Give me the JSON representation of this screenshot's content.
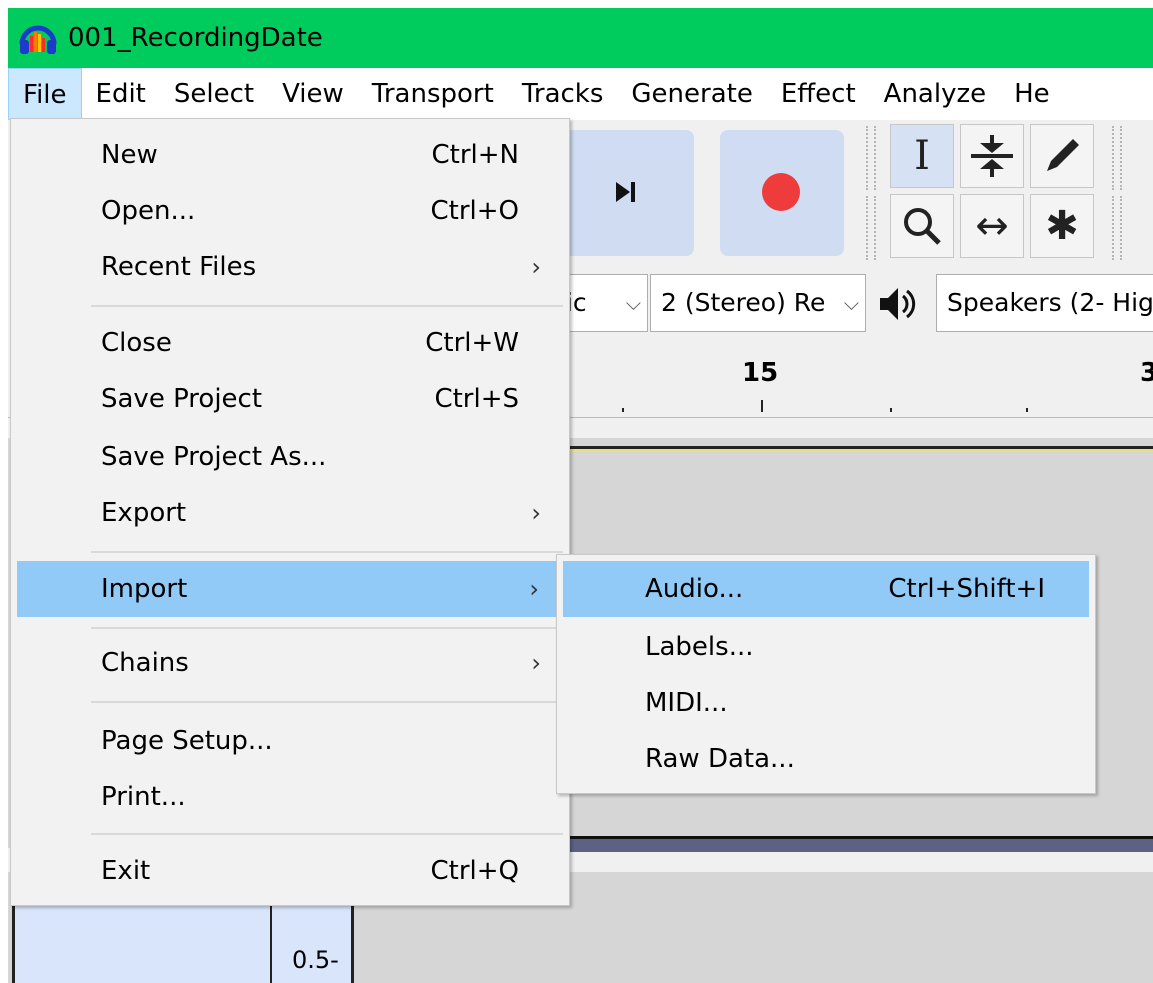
{
  "window": {
    "title": "001_RecordingDate"
  },
  "menubar": {
    "items": [
      "File",
      "Edit",
      "Select",
      "View",
      "Transport",
      "Tracks",
      "Generate",
      "Effect",
      "Analyze",
      "He"
    ]
  },
  "toolbar": {
    "skip_end_icon": "skip-to-end-icon",
    "record_icon": "record-icon",
    "record_color": "#ee3b3b",
    "tools": {
      "selection": "I",
      "envelope": "envelope-icon",
      "draw": "pencil-icon",
      "zoom": "zoom-icon",
      "timeshift": "↔",
      "multi": "✱"
    }
  },
  "devices": {
    "host_partial": "lic",
    "channels": "2 (Stereo) Re",
    "output": "Speakers (2- Hig"
  },
  "ruler": {
    "tick_label": "15",
    "tick_label_right": "3"
  },
  "track": {
    "scale_label": "0.5-"
  },
  "file_menu": {
    "items": [
      {
        "label": "New",
        "shortcut": "Ctrl+N"
      },
      {
        "label": "Open...",
        "shortcut": "Ctrl+O"
      },
      {
        "label": "Recent Files",
        "arrow": "›"
      },
      {
        "label": "Close",
        "shortcut": "Ctrl+W"
      },
      {
        "label": "Save Project",
        "shortcut": "Ctrl+S"
      },
      {
        "label": "Save Project As..."
      },
      {
        "label": "Export",
        "arrow": "›"
      },
      {
        "label": "Import",
        "arrow": "›"
      },
      {
        "label": "Chains",
        "arrow": "›"
      },
      {
        "label": "Page Setup..."
      },
      {
        "label": "Print..."
      },
      {
        "label": "Exit",
        "shortcut": "Ctrl+Q"
      }
    ]
  },
  "import_submenu": {
    "items": [
      {
        "label": "Audio...",
        "shortcut": "Ctrl+Shift+I"
      },
      {
        "label": "Labels..."
      },
      {
        "label": "MIDI..."
      },
      {
        "label": "Raw Data..."
      }
    ]
  },
  "colors": {
    "titlebar": "#00cc5e",
    "menu_highlight": "#91c9f7",
    "submenu_highlight": "#91c9f7"
  }
}
